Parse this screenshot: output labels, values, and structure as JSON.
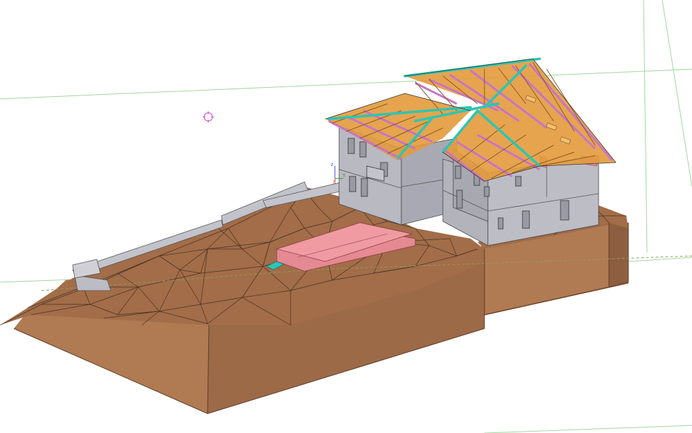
{
  "viewport": {
    "background": "#ffffff",
    "grid_color": "#9fd79f"
  },
  "axes": {
    "z_label": "z",
    "y_label": "Y",
    "x_label": "X",
    "z_color": "#3a4ad8",
    "y_color": "#2aa02a",
    "x_color": "#e03030"
  },
  "model": {
    "terrain_color": "#a9734e",
    "terrain_side_color": "#b07a52",
    "wall_color": "#b3b3bc",
    "roof_rafter_color": "#e39a3c",
    "roof_purlin_color": "#c873c8",
    "roof_ridge_color": "#2ac6b4",
    "slab_color": "#e58a93"
  },
  "pivot": {
    "icon": "target-icon",
    "color": "#d040d0"
  }
}
